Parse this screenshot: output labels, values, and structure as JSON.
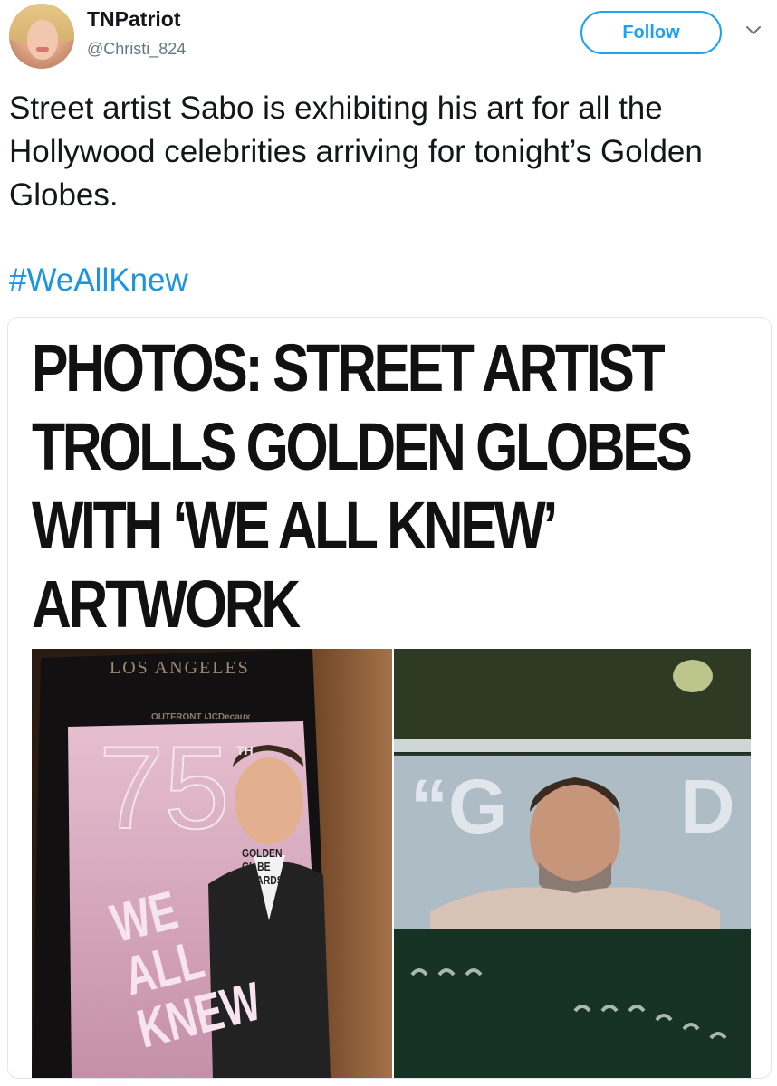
{
  "user": {
    "display_name": "TNPatriot",
    "handle": "@Christi_824"
  },
  "actions": {
    "follow_label": "Follow",
    "menu_icon": "chevron-down-icon"
  },
  "tweet": {
    "text": "Street artist Sabo is exhibiting his art for all the Hollywood celebrities arriving for tonight’s Golden Globes.",
    "hashtag": "#WeAllKnew"
  },
  "media": {
    "headline_lines": [
      "PHOTOS: STREET ARTIST",
      "TROLLS GOLDEN GLOBES",
      "WITH ‘WE ALL KNEW’",
      "ARTWORK"
    ],
    "left_photo": {
      "sign_text": "LOS ANGELES",
      "ad_operator": "OUTFRONT /JCDecaux",
      "number": "75",
      "number_suffix": "TH",
      "awards_text": [
        "GOLDEN",
        "GL  BE",
        "AWARDS"
      ],
      "graffiti": [
        "WE",
        "ALL",
        "KNEW"
      ]
    },
    "right_photo": {
      "letters": [
        "“G",
        "D"
      ]
    }
  },
  "colors": {
    "link": "#1b95e0",
    "follow": "#1da1f2",
    "text": "#14171a",
    "muted": "#657786"
  }
}
